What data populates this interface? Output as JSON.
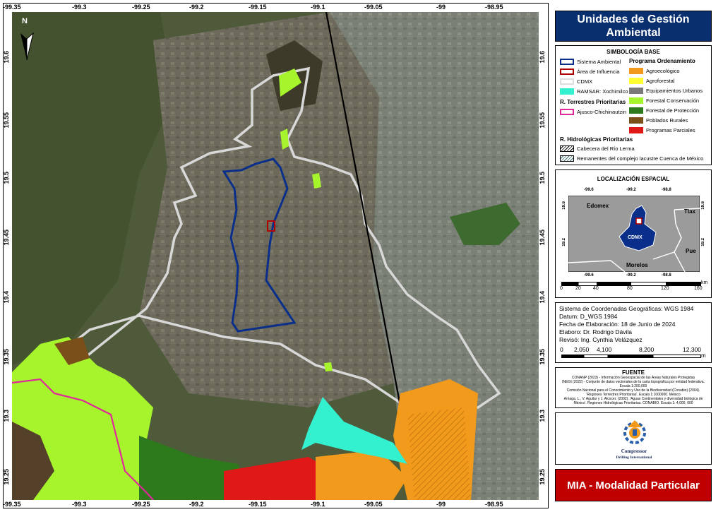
{
  "title": "Unidades de Gestión Ambiental",
  "map": {
    "north_label": "N",
    "top_ticks": [
      "-99.35",
      "-99.3",
      "-99.25",
      "-99.2",
      "-99.15",
      "-99.1",
      "-99.05",
      "-99",
      "-98.95"
    ],
    "bottom_ticks": [
      "-99.35",
      "-99.3",
      "-99.25",
      "-99.2",
      "-99.15",
      "-99.1",
      "-99.05",
      "-99",
      "-98.95"
    ],
    "left_ticks": [
      "19.6",
      "19.55",
      "19.5",
      "19.45",
      "19.4",
      "19.35",
      "19.3",
      "19.25"
    ],
    "right_ticks": [
      "19.6",
      "19.55",
      "19.5",
      "19.45",
      "19.4",
      "19.35",
      "19.3",
      "19.25"
    ]
  },
  "legend": {
    "heading": "SIMBOLOGÍA BASE",
    "base": [
      {
        "label": "Sistema Ambiental",
        "color": "#0a2f8a"
      },
      {
        "label": "Área de Influencia",
        "color": "#b00000"
      },
      {
        "label": "CDMX",
        "color": "#dddddd"
      },
      {
        "label": "RAMSAR: Xochimilco",
        "color": "#33f0cf"
      }
    ],
    "terrestres_heading": "R. Terrestres Prioritarias",
    "terrestres": [
      {
        "label": "Ajusco-Chichinautzin",
        "color": "#e0279b"
      }
    ],
    "programa_heading": "Programa Ordenamiento",
    "programa": [
      {
        "label": "Agroecológico",
        "color": "#f29a1c"
      },
      {
        "label": "Agroforestal",
        "color": "#ffff33"
      },
      {
        "label": "Equipamientos Urbanos",
        "color": "#7a7a7a"
      },
      {
        "label": "Forestal Conservación",
        "color": "#a6f52c"
      },
      {
        "label": "Forestal de Protección",
        "color": "#2c7a1c"
      },
      {
        "label": "Poblados Rurales",
        "color": "#7a4f1a"
      },
      {
        "label": "Programas Parciales",
        "color": "#e01818"
      }
    ],
    "hidro_heading": "R. Hidrológicas Prioritarias",
    "hidro": [
      {
        "label": "Cabecera del Río Lerma",
        "color": "#000000"
      },
      {
        "label": "Remanentes del complejo lacustre Cuenca de México",
        "color": "#3a6e6e"
      }
    ]
  },
  "locator": {
    "heading": "LOCALIZACIÓN ESPACIAL",
    "top_ticks": [
      "-99.6",
      "-99.2",
      "-98.8"
    ],
    "bottom_ticks": [
      "-99.6",
      "-99.2",
      "-98.8"
    ],
    "left_ticks": [
      "19.6",
      "19.2"
    ],
    "right_ticks": [
      "19.6",
      "19.2"
    ],
    "labels": {
      "edomex": "Edomex",
      "tlax": "Tlax",
      "cdmx": "CDMX",
      "pue": "Pue",
      "morelos": "Morelos"
    },
    "scale_ticks": [
      "0",
      "20",
      "40",
      "80",
      "120",
      "160"
    ],
    "scale_unit": "km"
  },
  "info": {
    "lines": [
      "Sistema de Coordenadas Geográficas: WGS 1984",
      "Datum: D_WGS 1984",
      "Fecha de Elaboración: 18 de Junio de 2024",
      "Elaboro: Dr. Rodrigo Dávila",
      "Revisó: Ing. Cynthia Velázquez"
    ],
    "scale_ticks": [
      "0",
      "2,050",
      "4,100",
      "8,200",
      "12,300"
    ],
    "scale_unit": "m"
  },
  "fuente": {
    "heading": "FUENTE",
    "lines": [
      "CONANP (2023) - Información Geoespacial de las Áreas Naturales Protegidas",
      "INEGI (2022) - Conjunto de datos vectoriales de la carta topográfica por entidad federativa.",
      "Escala 1:250,000",
      "Comisión Nacional para el Conocimiento y Uso de la Biodiversidad (Conabio) (2004).",
      "'Regiones Terrestres Prioritarias'. Escala 1:1000000. México",
      "Arriaga, L., V. Aguilar y J. Alcocer. (2002). 'Aguas Continentales y diversidad  biológica de",
      "México'. Regiones Hidrológicas Prioritarias. CONABIO. Escala 1: 4,000, 000"
    ]
  },
  "logo": {
    "line1": "Compressor",
    "line2": "Drilling International"
  },
  "footer": "MIA - Modalidad Particular"
}
